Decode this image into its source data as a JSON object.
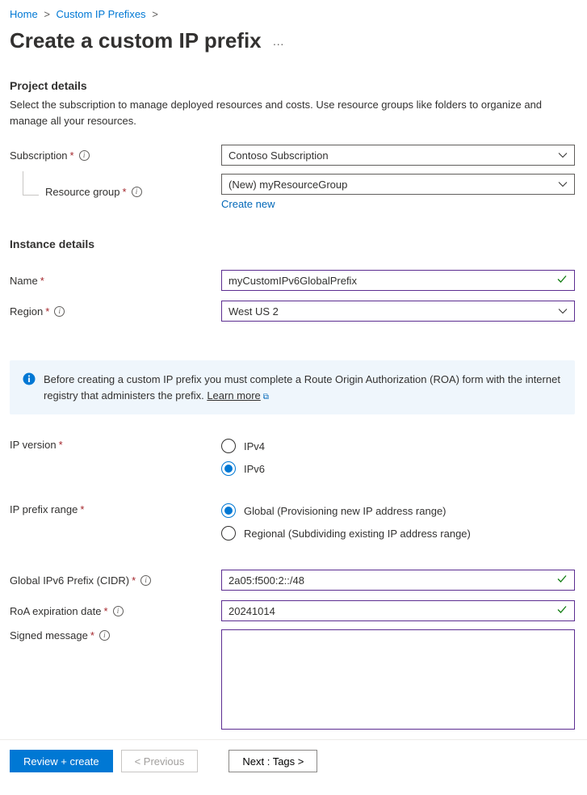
{
  "breadcrumb": {
    "home": "Home",
    "parent": "Custom IP Prefixes"
  },
  "page_title": "Create a custom IP prefix",
  "project": {
    "heading": "Project details",
    "description": "Select the subscription to manage deployed resources and costs. Use resource groups like folders to organize and manage all your resources.",
    "subscription_label": "Subscription",
    "subscription_value": "Contoso Subscription",
    "resource_group_label": "Resource group",
    "resource_group_value": "(New) myResourceGroup",
    "create_new": "Create new"
  },
  "instance": {
    "heading": "Instance details",
    "name_label": "Name",
    "name_value": "myCustomIPv6GlobalPrefix",
    "region_label": "Region",
    "region_value": "West US 2"
  },
  "banner": {
    "text": "Before creating a custom IP prefix you must complete a Route Origin Authorization (ROA) form with the internet registry that administers the prefix. ",
    "learn_more": "Learn more"
  },
  "ip": {
    "version_label": "IP version",
    "version_options": {
      "v4": "IPv4",
      "v6": "IPv6"
    },
    "version_selected": "v6",
    "range_label": "IP prefix range",
    "range_options": {
      "global": "Global (Provisioning new IP address range)",
      "regional": "Regional (Subdividing existing IP address range)"
    },
    "range_selected": "global",
    "cidr_label": "Global IPv6 Prefix (CIDR)",
    "cidr_value": "2a05:f500:2::/48",
    "roa_label": "RoA expiration date",
    "roa_value": "20241014",
    "signed_label": "Signed message",
    "signed_value": ""
  },
  "footer": {
    "review": "Review + create",
    "previous": "< Previous",
    "next": "Next : Tags >"
  }
}
